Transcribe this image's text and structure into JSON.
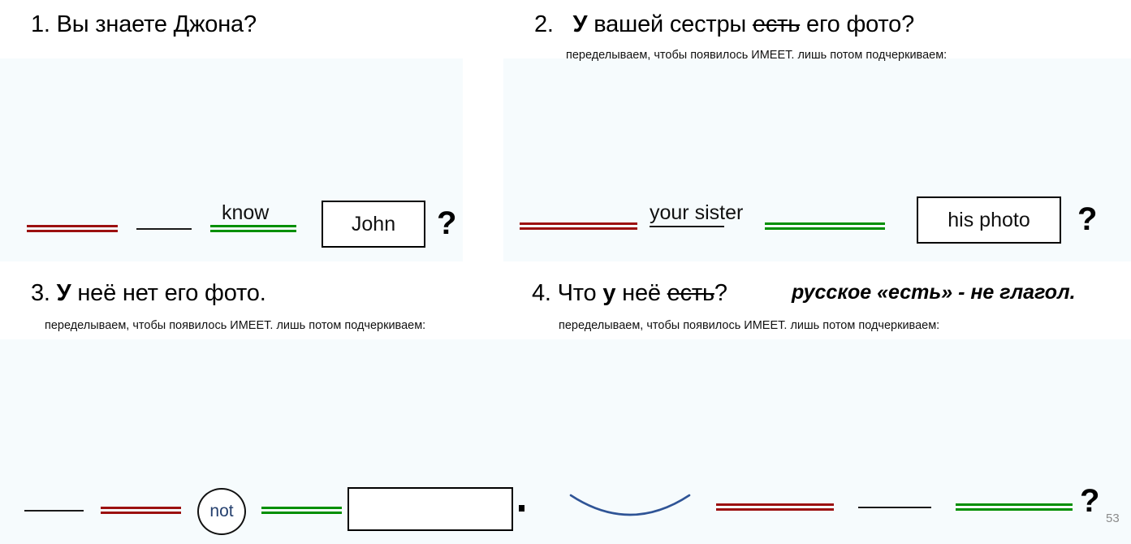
{
  "slide": {
    "page_number": "53",
    "background": "#ffffff",
    "tint_color": "#f6fbfd",
    "colors": {
      "subject_red": "#9c1010",
      "object_green": "#008f00",
      "verb_black": "#1a1a1a",
      "not_navy": "#25406e",
      "arc_blue": "#2f5496"
    }
  },
  "items": [
    {
      "number": "1.",
      "prompt_parts": [
        {
          "text": "Вы знаете Джона?",
          "bold": false,
          "strike": false
        }
      ],
      "note": "",
      "diagram": {
        "subject_line": "double-red",
        "verb_line": "black",
        "object_label": "know",
        "object_line": "double-green",
        "box_text": "John",
        "terminator": "?"
      }
    },
    {
      "number": "2.",
      "prompt_parts": [
        {
          "text": "У",
          "bold": true,
          "strike": false
        },
        {
          "text": " вашей сестры ",
          "bold": false,
          "strike": false
        },
        {
          "text": "есть",
          "bold": false,
          "strike": true
        },
        {
          "text": " его фото?",
          "bold": false,
          "strike": false
        }
      ],
      "note": "переделываем, чтобы появилось ИМЕЕТ. лишь потом подчеркиваем:",
      "diagram": {
        "subject_line": "double-red",
        "verb_label": "your sister",
        "verb_line": "black",
        "object_line": "double-green",
        "box_text": "his photo",
        "terminator": "?"
      }
    },
    {
      "number": "3.",
      "prompt_parts": [
        {
          "text": "У",
          "bold": true,
          "strike": false
        },
        {
          "text": " неё нет его фото.",
          "bold": false,
          "strike": false
        }
      ],
      "note": "переделываем, чтобы появилось ИМЕЕТ. лишь потом подчеркиваем:",
      "diagram": {
        "first_line": "black",
        "subject_line": "double-red",
        "modifier_circle": "not",
        "object_line": "double-green",
        "box_text": "",
        "terminator": "."
      }
    },
    {
      "number": "4.",
      "prompt_parts": [
        {
          "text": "Что ",
          "bold": false,
          "strike": false
        },
        {
          "text": "у",
          "bold": true,
          "strike": false
        },
        {
          "text": " неё ",
          "bold": false,
          "strike": false
        },
        {
          "text": "есть",
          "bold": false,
          "strike": true
        },
        {
          "text": "?",
          "bold": false,
          "strike": false
        }
      ],
      "aside": "русское «есть» - не глагол.",
      "note": "переделываем, чтобы появилось ИМЕЕТ. лишь потом подчеркиваем:",
      "diagram": {
        "arc": "blue-arc",
        "subject_line": "double-red",
        "verb_line": "black",
        "object_line": "double-green",
        "terminator": "?"
      }
    }
  ]
}
